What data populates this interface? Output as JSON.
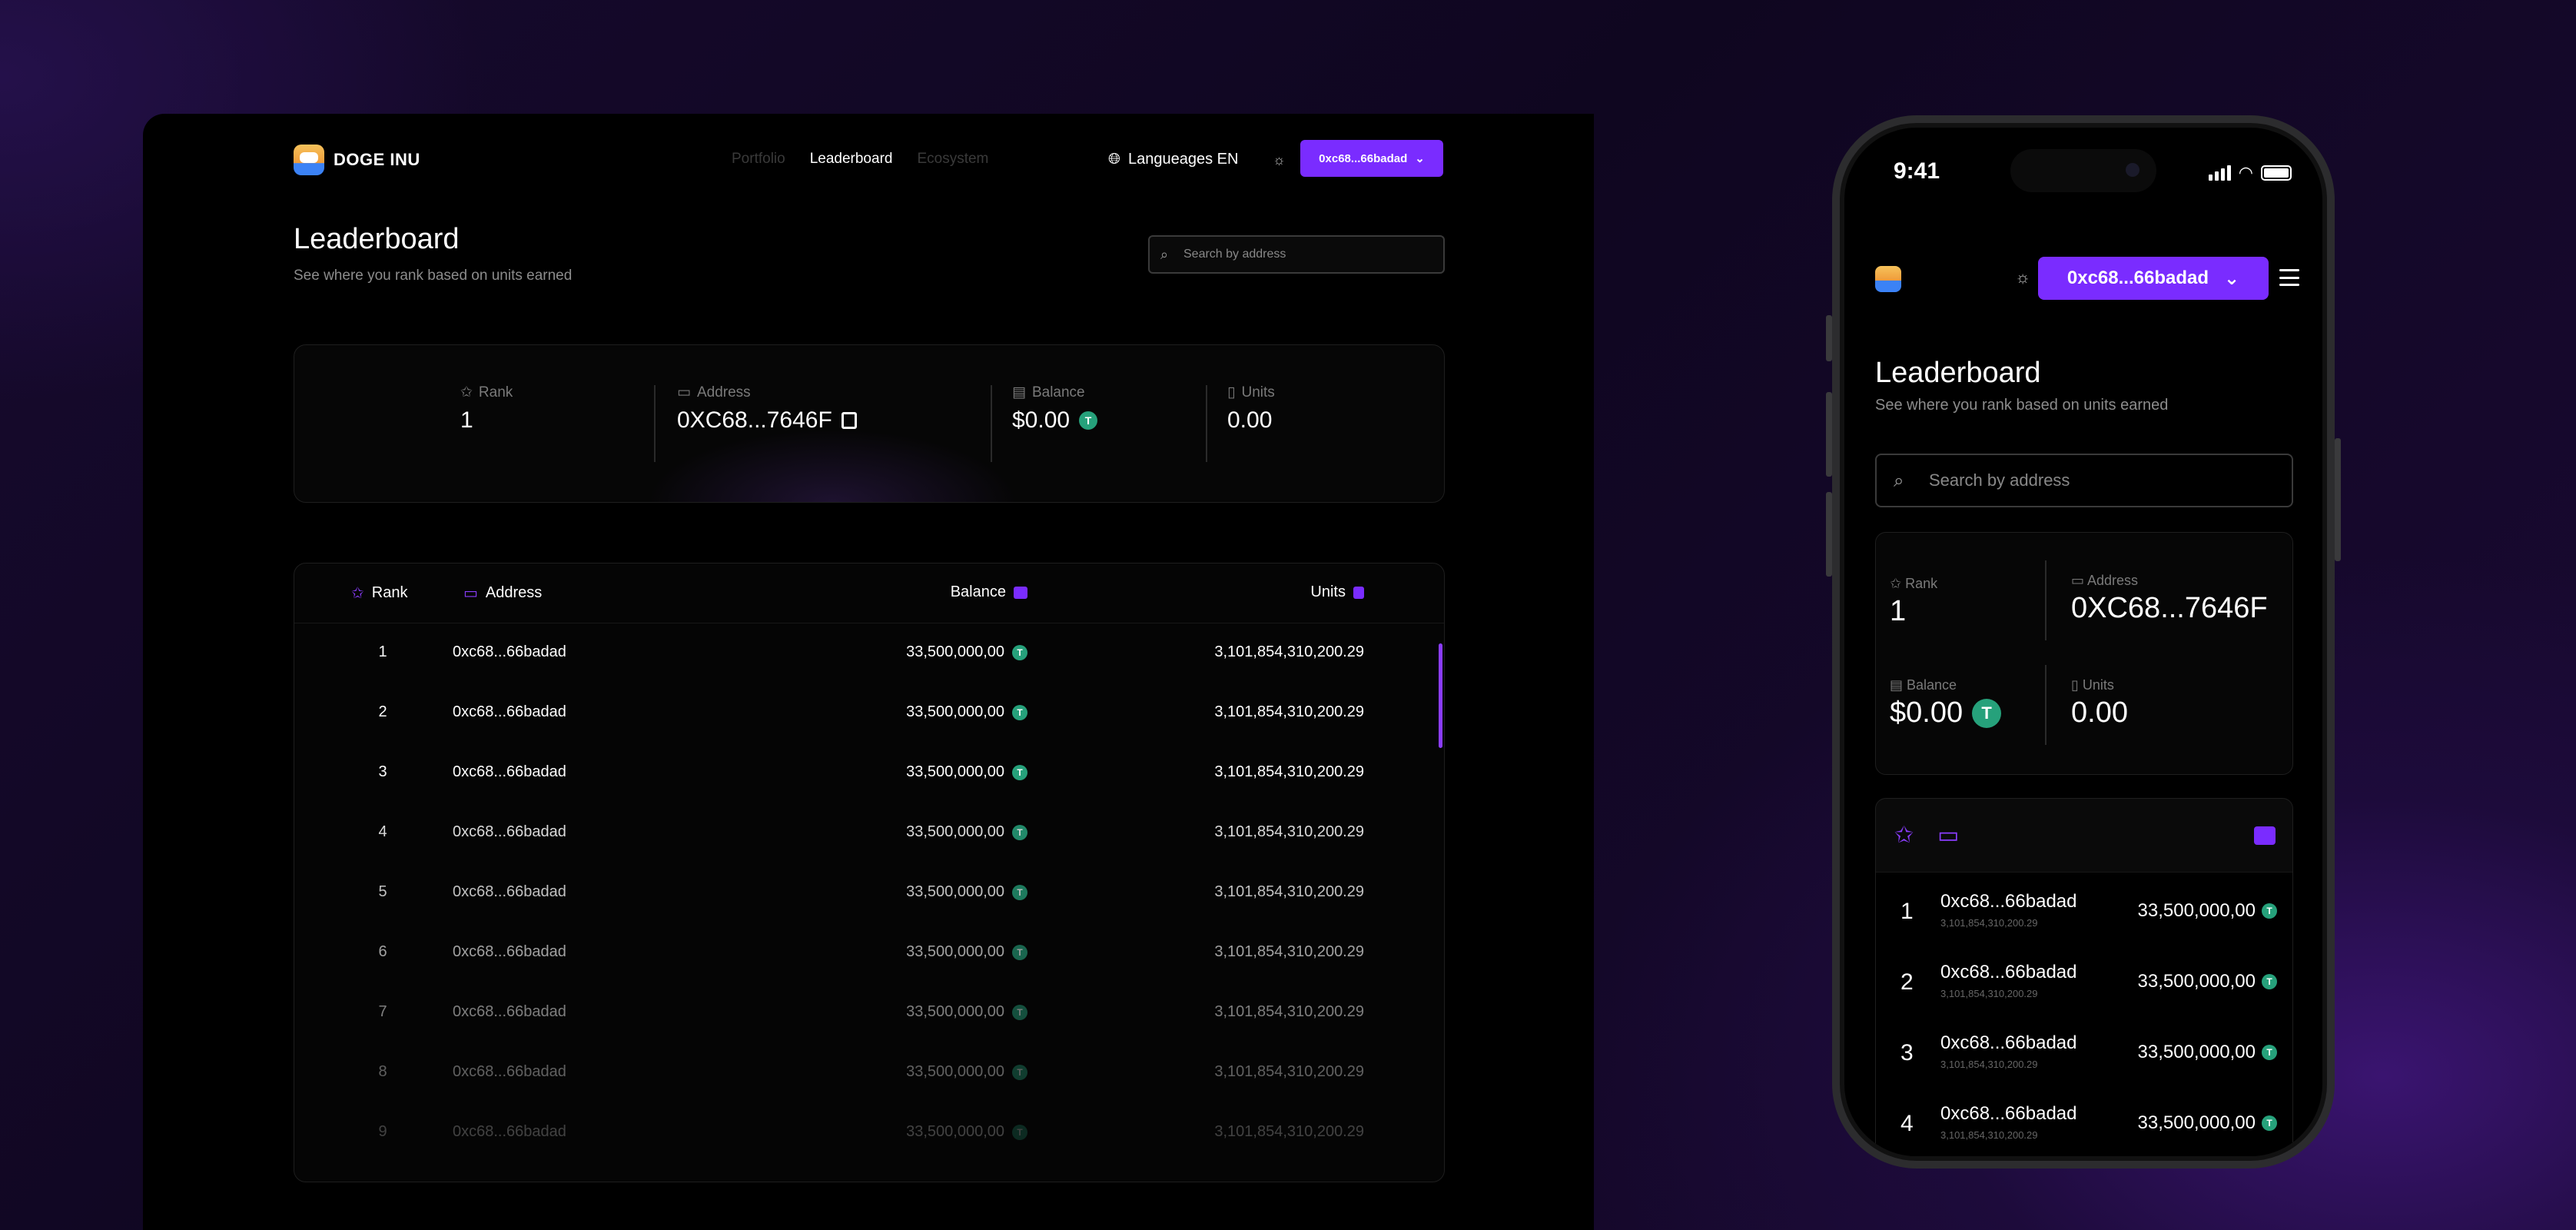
{
  "brand": {
    "name": "DOGE INU"
  },
  "nav": {
    "items": [
      "Portfolio",
      "Leaderboard",
      "Ecosystem"
    ],
    "active": 1
  },
  "language": {
    "label": "Langueages EN"
  },
  "wallet": {
    "short": "0xc68...66badad"
  },
  "page": {
    "title": "Leaderboard",
    "subtitle": "See where you rank based on units earned"
  },
  "search": {
    "placeholder": "Search by address"
  },
  "stats": {
    "rank_label": "Rank",
    "rank_value": "1",
    "address_label": "Address",
    "address_value": "0XC68...7646F",
    "balance_label": "Balance",
    "balance_value": "$0.00",
    "units_label": "Units",
    "units_value": "0.00"
  },
  "table": {
    "headers": {
      "rank": "Rank",
      "address": "Address",
      "balance": "Balance",
      "units": "Units"
    },
    "rows": [
      {
        "rank": "1",
        "address": "0xc68...66badad",
        "balance": "33,500,000,00",
        "units": "3,101,854,310,200.29",
        "opacity": 1
      },
      {
        "rank": "2",
        "address": "0xc68...66badad",
        "balance": "33,500,000,00",
        "units": "3,101,854,310,200.29",
        "opacity": 1
      },
      {
        "rank": "3",
        "address": "0xc68...66badad",
        "balance": "33,500,000,00",
        "units": "3,101,854,310,200.29",
        "opacity": 1
      },
      {
        "rank": "4",
        "address": "0xc68...66badad",
        "balance": "33,500,000,00",
        "units": "3,101,854,310,200.29",
        "opacity": 0.85
      },
      {
        "rank": "5",
        "address": "0xc68...66badad",
        "balance": "33,500,000,00",
        "units": "3,101,854,310,200.29",
        "opacity": 0.75
      },
      {
        "rank": "6",
        "address": "0xc68...66badad",
        "balance": "33,500,000,00",
        "units": "3,101,854,310,200.29",
        "opacity": 0.62
      },
      {
        "rank": "7",
        "address": "0xc68...66badad",
        "balance": "33,500,000,00",
        "units": "3,101,854,310,200.29",
        "opacity": 0.48
      },
      {
        "rank": "8",
        "address": "0xc68...66badad",
        "balance": "33,500,000,00",
        "units": "3,101,854,310,200.29",
        "opacity": 0.36
      },
      {
        "rank": "9",
        "address": "0xc68...66badad",
        "balance": "33,500,000,00",
        "units": "3,101,854,310,200.29",
        "opacity": 0.24
      }
    ]
  },
  "mobile": {
    "time": "9:41",
    "wallet": "0xc68...66badad",
    "rows": [
      {
        "rank": "1",
        "address": "0xc68...66badad",
        "units": "3,101,854,310,200.29",
        "balance": "33,500,000,00"
      },
      {
        "rank": "2",
        "address": "0xc68...66badad",
        "units": "3,101,854,310,200.29",
        "balance": "33,500,000,00"
      },
      {
        "rank": "3",
        "address": "0xc68...66badad",
        "units": "3,101,854,310,200.29",
        "balance": "33,500,000,00"
      },
      {
        "rank": "4",
        "address": "0xc68...66badad",
        "units": "3,101,854,310,200.29",
        "balance": "33,500,000,00"
      }
    ]
  },
  "colors": {
    "accent": "#7a2cff",
    "tether": "#26a17b",
    "background": "#000000"
  },
  "icons": [
    "logo-icon",
    "translate-icon",
    "sun-icon",
    "chevron-down-icon",
    "search-icon",
    "rank-star-icon",
    "wallet-icon",
    "balance-icon",
    "units-icon",
    "copy-icon",
    "tether-icon",
    "menu-icon"
  ]
}
